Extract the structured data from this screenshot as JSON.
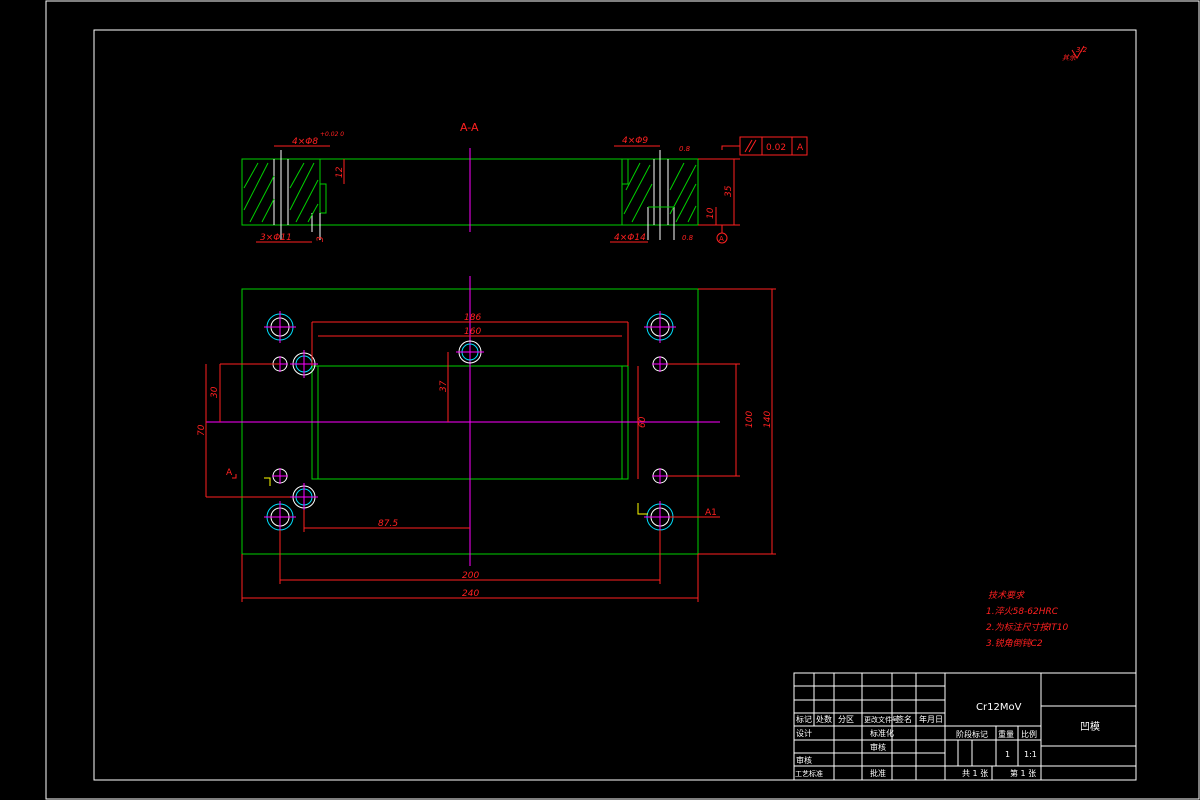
{
  "drawing": {
    "section_label": "A-A",
    "roughness_note": "3.2",
    "roughness_prefix": "其余",
    "flatness_value": "0.02",
    "flatness_datum": "A",
    "datum_label": "A",
    "section_marks": [
      "A",
      "A1"
    ]
  },
  "section_dims": {
    "top_left_holes": "4×Φ8",
    "top_left_tol": "+0.02 0",
    "depth_12": "12",
    "bottom_left_holes": "3×Φ11",
    "bottom_left_small": "3",
    "top_right_holes": "4×Φ9",
    "top_right_angle": "0.8",
    "height_35": "35",
    "height_10": "10",
    "bottom_right_holes": "4×Φ14",
    "bottom_right_note": "0.8"
  },
  "plan_dims": {
    "w186": "186",
    "w160": "160",
    "d37": "37",
    "d30": "30",
    "d70": "70",
    "d60": "60",
    "d100": "100",
    "d140": "140",
    "d87_5": "87.5",
    "d200": "200",
    "d240": "240"
  },
  "tech_notes": {
    "title": "技术要求",
    "lines": [
      "1.淬火58-62HRC",
      "2.为标注尺寸按IT10",
      "3.锐角倒钝C2"
    ]
  },
  "title_block": {
    "material": "Cr12MoV",
    "drawing_name": "凹模",
    "headers": [
      "标记",
      "处数",
      "分区",
      "更改文件号",
      "签名",
      "年月日"
    ],
    "rows_left": [
      "设计",
      "审核",
      "工艺标准"
    ],
    "rows_mid": [
      "标准化",
      "审核",
      "批准"
    ],
    "stage_labels": [
      "阶段标记",
      "重量",
      "比例"
    ],
    "weight_qty": "1",
    "scale": "1:1",
    "sheet_total": "共 1 张",
    "sheet_no": "第 1 张"
  }
}
